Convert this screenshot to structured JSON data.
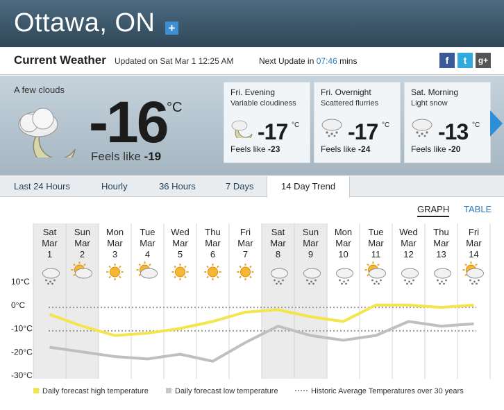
{
  "header": {
    "city": "Ottawa, ON",
    "add_label": "+"
  },
  "current_bar": {
    "title": "Current Weather",
    "updated": "Updated on Sat Mar 1 12:25 AM",
    "next_update_prefix": "Next Update in",
    "next_update_value": "07:46",
    "next_update_suffix": "mins",
    "social": [
      "f",
      "t",
      "g+"
    ]
  },
  "current": {
    "condition": "A few clouds",
    "icon": "cloud-moon-icon",
    "temp": "-16",
    "unit": "°C",
    "feels_label": "Feels like",
    "feels_value": "-19"
  },
  "forecast_cards": [
    {
      "period": "Fri. Evening",
      "condition": "Variable cloudiness",
      "icon": "cloud-moon-icon",
      "temp": "-17",
      "unit": "°C",
      "feels_label": "Feels like",
      "feels_value": "-23"
    },
    {
      "period": "Fri. Overnight",
      "condition": "Scattered flurries",
      "icon": "snow-cloud-icon",
      "temp": "-17",
      "unit": "°C",
      "feels_label": "Feels like",
      "feels_value": "-24"
    },
    {
      "period": "Sat. Morning",
      "condition": "Light snow",
      "icon": "snow-cloud-icon",
      "temp": "-13",
      "unit": "°C",
      "feels_label": "Feels like",
      "feels_value": "-20"
    }
  ],
  "tabs": [
    {
      "label": "Last 24 Hours",
      "active": false
    },
    {
      "label": "Hourly",
      "active": false
    },
    {
      "label": "36 Hours",
      "active": false
    },
    {
      "label": "7 Days",
      "active": false
    },
    {
      "label": "14 Day Trend",
      "active": true
    }
  ],
  "view_toggle": {
    "graph": "GRAPH",
    "table": "TABLE"
  },
  "colors": {
    "high": "#f2e64c",
    "low": "#bfbfbf",
    "historic": "#999999",
    "accent": "#2a7bc0",
    "weekend_shade": "#ebebeb"
  },
  "chart_data": {
    "type": "line",
    "days": [
      {
        "dow": "Sat",
        "month": "Mar",
        "day": "1",
        "icon": "snow-cloud-icon",
        "weekend": true
      },
      {
        "dow": "Sun",
        "month": "Mar",
        "day": "2",
        "icon": "sun-cloud-icon",
        "weekend": true
      },
      {
        "dow": "Mon",
        "month": "Mar",
        "day": "3",
        "icon": "sun-icon",
        "weekend": false
      },
      {
        "dow": "Tue",
        "month": "Mar",
        "day": "4",
        "icon": "sun-cloud-icon",
        "weekend": false
      },
      {
        "dow": "Wed",
        "month": "Mar",
        "day": "5",
        "icon": "sun-icon",
        "weekend": false
      },
      {
        "dow": "Thu",
        "month": "Mar",
        "day": "6",
        "icon": "sun-icon",
        "weekend": false
      },
      {
        "dow": "Fri",
        "month": "Mar",
        "day": "7",
        "icon": "sun-icon",
        "weekend": false
      },
      {
        "dow": "Sat",
        "month": "Mar",
        "day": "8",
        "icon": "snow-cloud-icon",
        "weekend": true
      },
      {
        "dow": "Sun",
        "month": "Mar",
        "day": "9",
        "icon": "snow-cloud-icon",
        "weekend": true
      },
      {
        "dow": "Mon",
        "month": "Mar",
        "day": "10",
        "icon": "snow-cloud-icon",
        "weekend": false
      },
      {
        "dow": "Tue",
        "month": "Mar",
        "day": "11",
        "icon": "sun-snow-cloud-icon",
        "weekend": false
      },
      {
        "dow": "Wed",
        "month": "Mar",
        "day": "12",
        "icon": "snow-cloud-icon",
        "weekend": false
      },
      {
        "dow": "Thu",
        "month": "Mar",
        "day": "13",
        "icon": "snow-cloud-icon",
        "weekend": false
      },
      {
        "dow": "Fri",
        "month": "Mar",
        "day": "14",
        "icon": "sun-snow-cloud-icon",
        "weekend": false
      }
    ],
    "y_ticks": [
      10,
      0,
      -10,
      -20,
      -30
    ],
    "y_tick_labels": [
      "10°C",
      "0°C",
      "-10°C",
      "-20°C",
      "-30°C"
    ],
    "ylim": [
      -30,
      10
    ],
    "series": [
      {
        "name": "Daily forecast high temperature",
        "values": [
          -4,
          -9,
          -13,
          -12,
          -10,
          -7,
          -3,
          -2,
          -5,
          -7,
          0,
          0,
          -1,
          0
        ]
      },
      {
        "name": "Daily forecast low temperature",
        "values": [
          -18,
          -20,
          -22,
          -23,
          -21,
          -24,
          -16,
          -9,
          -13,
          -15,
          -13,
          -7,
          -9,
          -8
        ]
      },
      {
        "name": "Historic Average Temperatures over 30 years",
        "values": [
          -1,
          -1,
          -1,
          -1,
          -1,
          -1,
          -1,
          -1,
          -1,
          -1,
          -1,
          -1,
          -1,
          -1
        ],
        "values_low": [
          -11,
          -11,
          -11,
          -11,
          -11,
          -11,
          -11,
          -11,
          -11,
          -11,
          -11,
          -11,
          -11,
          -11
        ]
      }
    ],
    "legend": [
      "Daily forecast high temperature",
      "Daily forecast low temperature",
      "Historic Average Temperatures over 30 years"
    ]
  }
}
